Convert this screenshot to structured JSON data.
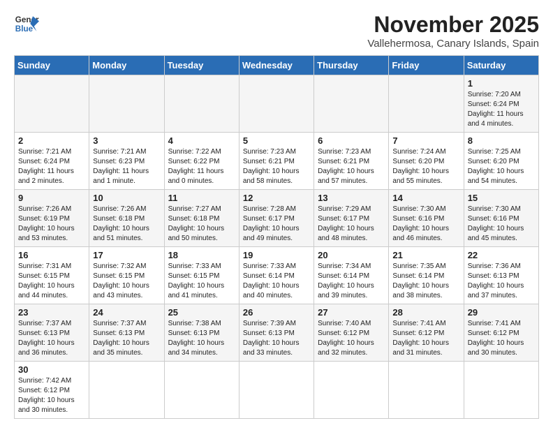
{
  "logo": {
    "text_general": "General",
    "text_blue": "Blue"
  },
  "title": "November 2025",
  "subtitle": "Vallehermosa, Canary Islands, Spain",
  "days_of_week": [
    "Sunday",
    "Monday",
    "Tuesday",
    "Wednesday",
    "Thursday",
    "Friday",
    "Saturday"
  ],
  "weeks": [
    [
      {
        "day": "",
        "info": ""
      },
      {
        "day": "",
        "info": ""
      },
      {
        "day": "",
        "info": ""
      },
      {
        "day": "",
        "info": ""
      },
      {
        "day": "",
        "info": ""
      },
      {
        "day": "",
        "info": ""
      },
      {
        "day": "1",
        "info": "Sunrise: 7:20 AM\nSunset: 6:24 PM\nDaylight: 11 hours\nand 4 minutes."
      }
    ],
    [
      {
        "day": "2",
        "info": "Sunrise: 7:21 AM\nSunset: 6:24 PM\nDaylight: 11 hours\nand 2 minutes."
      },
      {
        "day": "3",
        "info": "Sunrise: 7:21 AM\nSunset: 6:23 PM\nDaylight: 11 hours\nand 1 minute."
      },
      {
        "day": "4",
        "info": "Sunrise: 7:22 AM\nSunset: 6:22 PM\nDaylight: 11 hours\nand 0 minutes."
      },
      {
        "day": "5",
        "info": "Sunrise: 7:23 AM\nSunset: 6:21 PM\nDaylight: 10 hours\nand 58 minutes."
      },
      {
        "day": "6",
        "info": "Sunrise: 7:23 AM\nSunset: 6:21 PM\nDaylight: 10 hours\nand 57 minutes."
      },
      {
        "day": "7",
        "info": "Sunrise: 7:24 AM\nSunset: 6:20 PM\nDaylight: 10 hours\nand 55 minutes."
      },
      {
        "day": "8",
        "info": "Sunrise: 7:25 AM\nSunset: 6:20 PM\nDaylight: 10 hours\nand 54 minutes."
      }
    ],
    [
      {
        "day": "9",
        "info": "Sunrise: 7:26 AM\nSunset: 6:19 PM\nDaylight: 10 hours\nand 53 minutes."
      },
      {
        "day": "10",
        "info": "Sunrise: 7:26 AM\nSunset: 6:18 PM\nDaylight: 10 hours\nand 51 minutes."
      },
      {
        "day": "11",
        "info": "Sunrise: 7:27 AM\nSunset: 6:18 PM\nDaylight: 10 hours\nand 50 minutes."
      },
      {
        "day": "12",
        "info": "Sunrise: 7:28 AM\nSunset: 6:17 PM\nDaylight: 10 hours\nand 49 minutes."
      },
      {
        "day": "13",
        "info": "Sunrise: 7:29 AM\nSunset: 6:17 PM\nDaylight: 10 hours\nand 48 minutes."
      },
      {
        "day": "14",
        "info": "Sunrise: 7:30 AM\nSunset: 6:16 PM\nDaylight: 10 hours\nand 46 minutes."
      },
      {
        "day": "15",
        "info": "Sunrise: 7:30 AM\nSunset: 6:16 PM\nDaylight: 10 hours\nand 45 minutes."
      }
    ],
    [
      {
        "day": "16",
        "info": "Sunrise: 7:31 AM\nSunset: 6:15 PM\nDaylight: 10 hours\nand 44 minutes."
      },
      {
        "day": "17",
        "info": "Sunrise: 7:32 AM\nSunset: 6:15 PM\nDaylight: 10 hours\nand 43 minutes."
      },
      {
        "day": "18",
        "info": "Sunrise: 7:33 AM\nSunset: 6:15 PM\nDaylight: 10 hours\nand 41 minutes."
      },
      {
        "day": "19",
        "info": "Sunrise: 7:33 AM\nSunset: 6:14 PM\nDaylight: 10 hours\nand 40 minutes."
      },
      {
        "day": "20",
        "info": "Sunrise: 7:34 AM\nSunset: 6:14 PM\nDaylight: 10 hours\nand 39 minutes."
      },
      {
        "day": "21",
        "info": "Sunrise: 7:35 AM\nSunset: 6:14 PM\nDaylight: 10 hours\nand 38 minutes."
      },
      {
        "day": "22",
        "info": "Sunrise: 7:36 AM\nSunset: 6:13 PM\nDaylight: 10 hours\nand 37 minutes."
      }
    ],
    [
      {
        "day": "23",
        "info": "Sunrise: 7:37 AM\nSunset: 6:13 PM\nDaylight: 10 hours\nand 36 minutes."
      },
      {
        "day": "24",
        "info": "Sunrise: 7:37 AM\nSunset: 6:13 PM\nDaylight: 10 hours\nand 35 minutes."
      },
      {
        "day": "25",
        "info": "Sunrise: 7:38 AM\nSunset: 6:13 PM\nDaylight: 10 hours\nand 34 minutes."
      },
      {
        "day": "26",
        "info": "Sunrise: 7:39 AM\nSunset: 6:13 PM\nDaylight: 10 hours\nand 33 minutes."
      },
      {
        "day": "27",
        "info": "Sunrise: 7:40 AM\nSunset: 6:12 PM\nDaylight: 10 hours\nand 32 minutes."
      },
      {
        "day": "28",
        "info": "Sunrise: 7:41 AM\nSunset: 6:12 PM\nDaylight: 10 hours\nand 31 minutes."
      },
      {
        "day": "29",
        "info": "Sunrise: 7:41 AM\nSunset: 6:12 PM\nDaylight: 10 hours\nand 30 minutes."
      }
    ],
    [
      {
        "day": "30",
        "info": "Sunrise: 7:42 AM\nSunset: 6:12 PM\nDaylight: 10 hours\nand 30 minutes."
      },
      {
        "day": "",
        "info": ""
      },
      {
        "day": "",
        "info": ""
      },
      {
        "day": "",
        "info": ""
      },
      {
        "day": "",
        "info": ""
      },
      {
        "day": "",
        "info": ""
      },
      {
        "day": "",
        "info": ""
      }
    ]
  ]
}
